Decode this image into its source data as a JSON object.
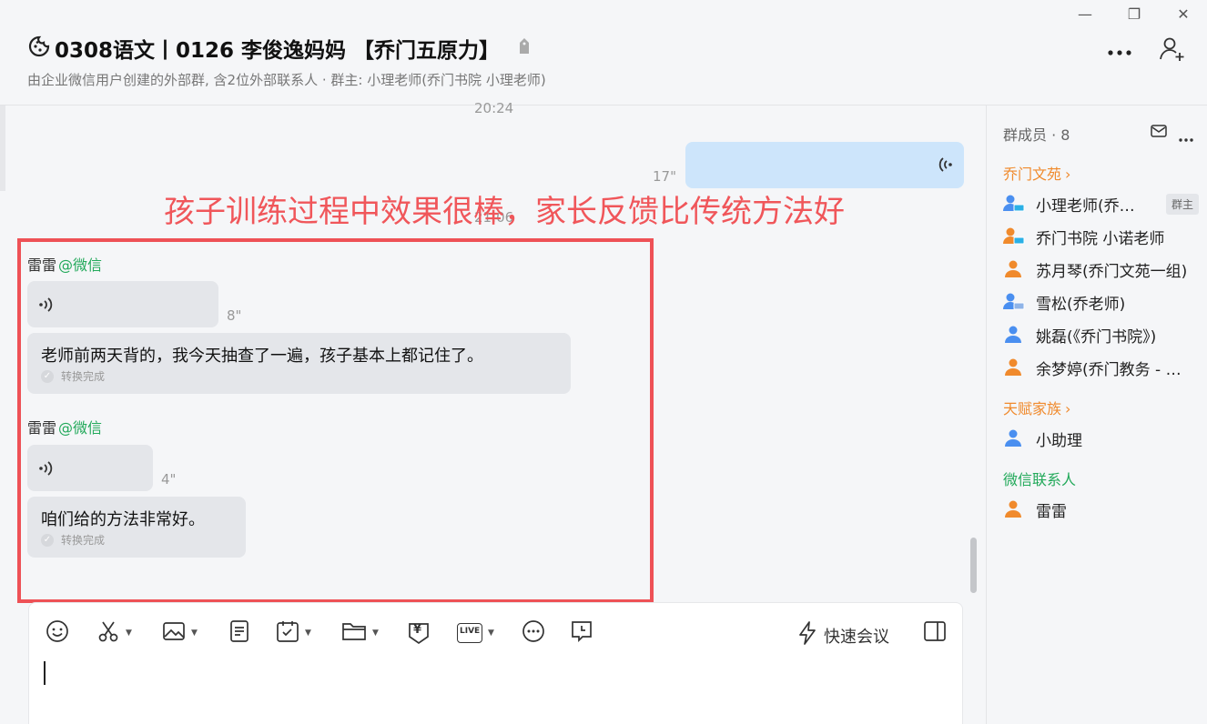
{
  "window": {
    "minimize": "—",
    "maximize": "❐",
    "close": "✕"
  },
  "header": {
    "title": "0308语文丨0126  李俊逸妈妈 【乔门五原力】",
    "subtitle": "由企业微信用户创建的外部群, 含2位外部联系人 · 群主: 小理老师(乔门书院 小理老师)",
    "more_label": "•••"
  },
  "chat": {
    "time_top": "20:24",
    "time_mid": "21:06",
    "outgoing_voice": {
      "duration": "17\""
    },
    "annotation": "孩子训练过程中效果很棒，家长反馈比传统方法好",
    "messages": [
      {
        "sender": "雷雷",
        "source": "@微信",
        "voice_duration": "8\"",
        "text": "老师前两天背的，我今天抽查了一遍，孩子基本上都记住了。",
        "converted": "转换完成"
      },
      {
        "sender": "雷雷",
        "source": "@微信",
        "voice_duration": "4\"",
        "text": "咱们给的方法非常好。",
        "converted": "转换完成"
      }
    ]
  },
  "composer": {
    "quick_meeting": "快速会议",
    "toolbar": [
      "emoji-icon",
      "scissors-icon",
      "image-icon",
      "document-icon",
      "calendar-check-icon",
      "folder-icon",
      "red-packet-icon",
      "live-icon",
      "more-circle-icon",
      "message-clock-icon"
    ],
    "live_text": "LIVE",
    "yuan": "¥"
  },
  "sidebar": {
    "members_header": "群成员 · 8",
    "groups": [
      {
        "name": "乔门文苑",
        "color": "#f08a2c",
        "members": [
          {
            "name": "小理老师(乔门书院 小理老师)",
            "badge": "群主",
            "icon": "person-pc-icon",
            "color": "#4a8ff0"
          },
          {
            "name": "乔门书院   小诺老师",
            "icon": "person-pc-icon",
            "color": "#f08a2c"
          },
          {
            "name": "苏月琴(乔门文苑一组)",
            "icon": "person-icon",
            "color": "#f08a2c"
          },
          {
            "name": "雪松(乔老师)",
            "icon": "person-pc-icon",
            "color": "#4a8ff0"
          },
          {
            "name": "姚磊(《乔门书院》)",
            "icon": "person-icon",
            "color": "#4a8ff0"
          },
          {
            "name": "余梦婷(乔门教务 - 小婷)",
            "icon": "person-icon",
            "color": "#f08a2c"
          }
        ]
      },
      {
        "name": "天赋家族",
        "color": "#f08a2c",
        "members": [
          {
            "name": "小助理",
            "icon": "person-icon",
            "color": "#4a8ff0"
          }
        ]
      },
      {
        "name": "微信联系人",
        "color": "#22a95a",
        "members": [
          {
            "name": "雷雷",
            "icon": "person-icon",
            "color": "#f08a2c"
          }
        ]
      }
    ]
  }
}
